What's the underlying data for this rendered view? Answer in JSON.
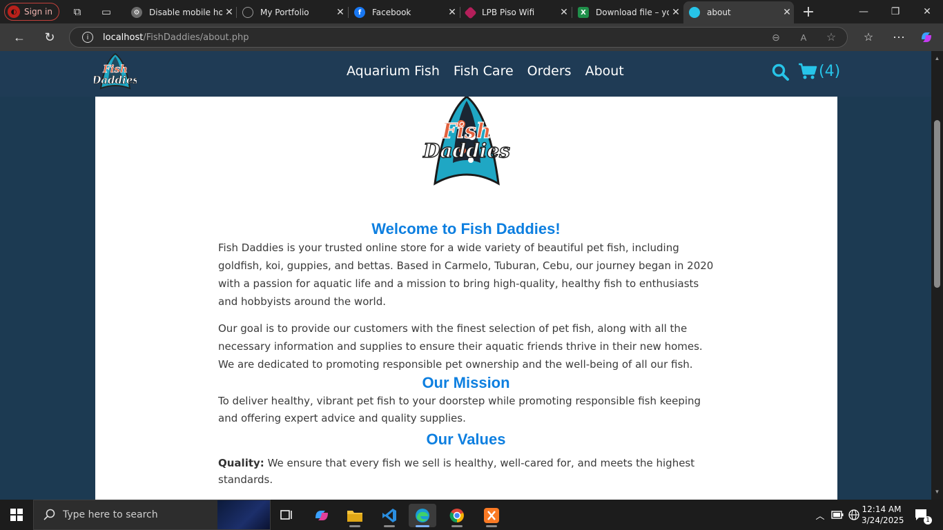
{
  "browser": {
    "signin_label": "Sign in",
    "tabs": [
      {
        "title": "Disable mobile hor",
        "icon": "gear-circle-icon",
        "color": "#6b6b6b"
      },
      {
        "title": "My Portfolio",
        "icon": "globe-icon",
        "color": "#6b6b6b"
      },
      {
        "title": "Facebook",
        "icon": "facebook-icon",
        "color": "#1877f2"
      },
      {
        "title": "LPB Piso Wifi",
        "icon": "lpb-logo-icon",
        "color": "#b41f5a"
      },
      {
        "title": "Download file – yo",
        "icon": "excel-x-icon",
        "color": "#1f8f4a"
      },
      {
        "title": "about",
        "icon": "fish-daddies-favicon",
        "color": "#27c4e8"
      }
    ],
    "url_host": "localhost",
    "url_path": "/FishDaddies/about.php"
  },
  "site": {
    "nav": [
      "Aquarium Fish",
      "Fish Care",
      "Orders",
      "About"
    ],
    "cart_count": "(4)",
    "logo_line1": "Fish",
    "logo_line2": "Daddies",
    "accent_color": "#0d7fe0",
    "header_color": "#1f3b55"
  },
  "about": {
    "welcome_heading": "Welcome to Fish Daddies!",
    "intro_p1": "Fish Daddies is your trusted online store for a wide variety of beautiful pet fish, including goldfish, koi, guppies, and bettas. Based in Carmelo, Tuburan, Cebu, our journey began in 2020 with a passion for aquatic life and a mission to bring high-quality, healthy fish to enthusiasts and hobbyists around the world.",
    "intro_p2": "Our goal is to provide our customers with the finest selection of pet fish, along with all the necessary information and supplies to ensure their aquatic friends thrive in their new homes. We are dedicated to promoting responsible pet ownership and the well-being of all our fish.",
    "mission_heading": "Our Mission",
    "mission_text": "To deliver healthy, vibrant pet fish to your doorstep while promoting responsible fish keeping and offering expert advice and quality supplies.",
    "values_heading": "Our Values",
    "values": [
      {
        "label": "Quality:",
        "text": "We ensure that every fish we sell is healthy, well-cared for, and meets the highest standards."
      }
    ]
  },
  "taskbar": {
    "search_placeholder": "Type here to search",
    "time": "12:14 AM",
    "date": "3/24/2025",
    "notification_count": "1"
  }
}
